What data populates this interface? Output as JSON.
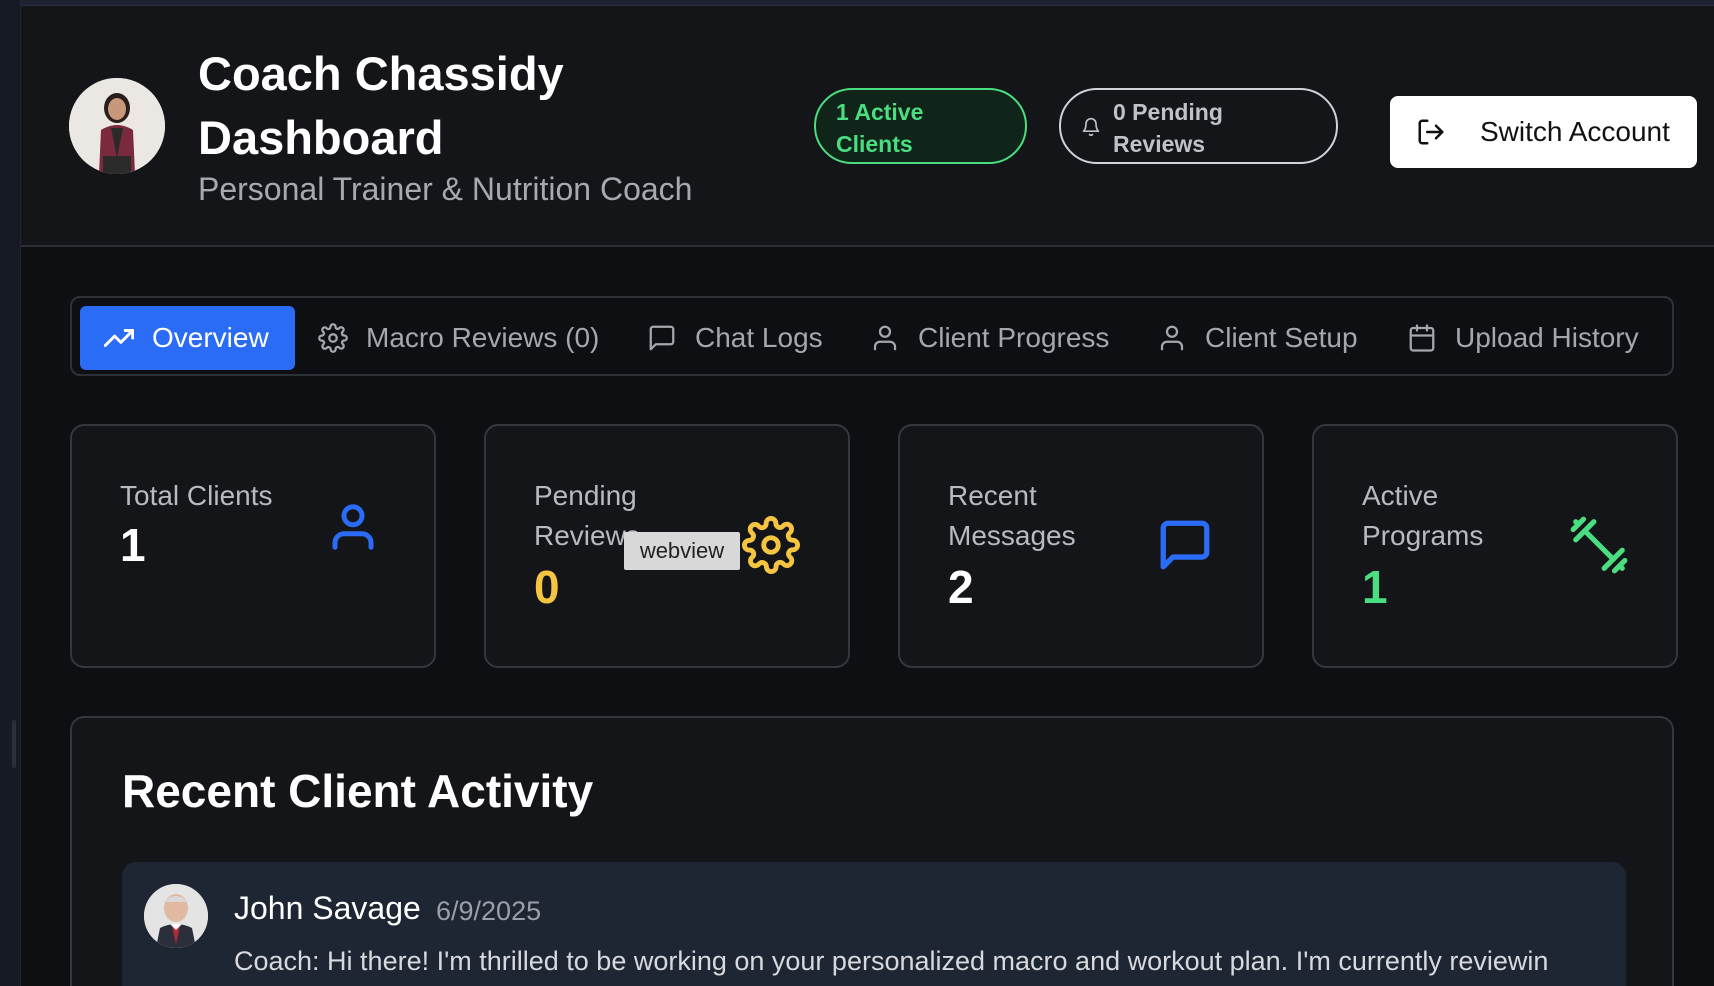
{
  "header": {
    "title": "Coach Chassidy Dashboard",
    "subtitle": "Personal Trainer & Nutrition Coach",
    "active_clients_badge": "1 Active Clients",
    "pending_reviews_badge": "0 Pending Reviews",
    "switch_account_label": "Switch Account"
  },
  "tabs": [
    {
      "label": "Overview",
      "icon": "trending-up-icon",
      "active": true
    },
    {
      "label": "Macro Reviews (0)",
      "icon": "gear-icon"
    },
    {
      "label": "Chat Logs",
      "icon": "chat-icon"
    },
    {
      "label": "Client Progress",
      "icon": "user-icon"
    },
    {
      "label": "Client Setup",
      "icon": "user-icon"
    },
    {
      "label": "Upload History",
      "icon": "calendar-icon"
    }
  ],
  "stats": [
    {
      "label": "Total Clients",
      "value": "1",
      "icon": "user-icon",
      "color": "#2b6cf6"
    },
    {
      "label": "Pending Reviews",
      "value": "0",
      "icon": "gear-icon",
      "color": "#f5c542"
    },
    {
      "label": "Recent Messages",
      "value": "2",
      "icon": "chat-icon",
      "color": "#2b6cf6"
    },
    {
      "label": "Active Programs",
      "value": "1",
      "icon": "dumbbell-icon",
      "color": "#4ade80"
    }
  ],
  "tooltip": "webview",
  "activity": {
    "title": "Recent Client Activity",
    "items": [
      {
        "name": "John Savage",
        "date": "6/9/2025",
        "message": "Coach: Hi there! I'm thrilled to be working on your personalized macro and workout plan. I'm currently reviewin"
      }
    ]
  },
  "colors": {
    "accent": "#2b6cf6",
    "success": "#4ade80",
    "warning": "#f5c542"
  }
}
